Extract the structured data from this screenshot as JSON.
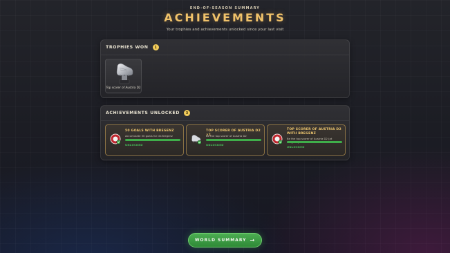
{
  "header": {
    "eyebrow": "END-OF-SEASON SUMMARY",
    "title": "ACHIEVEMENTS",
    "subtitle": "Your trophies and achievements unlocked since your last visit"
  },
  "trophies": {
    "title": "TROPHIES WON",
    "count": "1",
    "items": [
      {
        "label": "Top scorer of Austria D2",
        "icon": "silver-boot-trophy-icon"
      }
    ]
  },
  "achievements": {
    "title": "ACHIEVEMENTS UNLOCKED",
    "count": "3",
    "items": [
      {
        "title": "50 GOALS WITH BREGENZ",
        "description": "Accumulate 50 goals for dir.Bregenz",
        "status": "UNLOCKED",
        "progress": 1.0,
        "icon": "club-badge-icon"
      },
      {
        "title": "TOP SCORER OF AUSTRIA D2 ×1",
        "description": "Be the top scorer of Austria D2",
        "status": "UNLOCKED",
        "progress": 1.0,
        "icon": "boot-icon"
      },
      {
        "title": "TOP SCORER OF AUSTRIA D2 WITH BREGENZ",
        "description": "Be the top scorer of Austria D2 (at Bregenz)",
        "status": "UNLOCKED",
        "progress": 1.0,
        "icon": "club-badge-icon"
      }
    ]
  },
  "footer": {
    "button_label": "WORLD SUMMARY",
    "button_arrow": "→"
  },
  "colors": {
    "accent_gold": "#f0c26a",
    "progress_green": "#3fae4a",
    "button_green": "#4cae52"
  }
}
